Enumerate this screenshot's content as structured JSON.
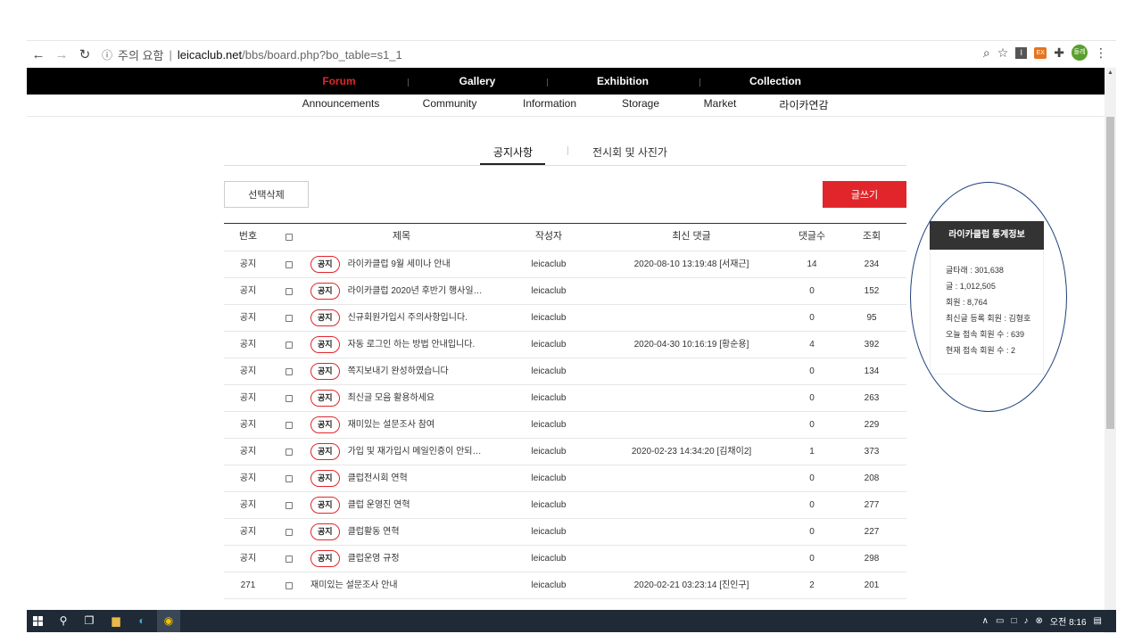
{
  "browser": {
    "security_label": "주의 요함",
    "url_host": "leicaclub.net",
    "url_path": "/bbs/board.php?bo_table=s1_1",
    "profile_text": "돌레"
  },
  "topnav": [
    "Forum",
    "Gallery",
    "Exhibition",
    "Collection"
  ],
  "subnav": [
    "Announcements",
    "Community",
    "Information",
    "Storage",
    "Market",
    "라이카연감"
  ],
  "tabs": [
    "공지사항",
    "전시회 및 사진가"
  ],
  "buttons": {
    "delete_selected": "선택삭제",
    "write": "글쓰기"
  },
  "table": {
    "headers": {
      "num": "번호",
      "title": "제목",
      "writer": "작성자",
      "last_comment": "최신 댓글",
      "comments": "댓글수",
      "views": "조회"
    },
    "notice_badge": "공지",
    "rows": [
      {
        "num": "공지",
        "notice": true,
        "title": "라이카클럽 9월 세미나 안내",
        "writer": "leicaclub",
        "last_comment": "2020-08-10 13:19:48 [서재근]",
        "comments": "14",
        "views": "234"
      },
      {
        "num": "공지",
        "notice": true,
        "title": "라이카클럽 2020년 후반기 행사일…",
        "writer": "leicaclub",
        "last_comment": "",
        "comments": "0",
        "views": "152"
      },
      {
        "num": "공지",
        "notice": true,
        "title": "신규회원가입시 주의사항입니다.",
        "writer": "leicaclub",
        "last_comment": "",
        "comments": "0",
        "views": "95"
      },
      {
        "num": "공지",
        "notice": true,
        "title": "자동 로그인 하는 방법 안내입니다.",
        "writer": "leicaclub",
        "last_comment": "2020-04-30 10:16:19 [황순용]",
        "comments": "4",
        "views": "392"
      },
      {
        "num": "공지",
        "notice": true,
        "title": "쪽지보내기 완성하였습니다",
        "writer": "leicaclub",
        "last_comment": "",
        "comments": "0",
        "views": "134"
      },
      {
        "num": "공지",
        "notice": true,
        "title": "최신글 모음 활용하세요",
        "writer": "leicaclub",
        "last_comment": "",
        "comments": "0",
        "views": "263"
      },
      {
        "num": "공지",
        "notice": true,
        "title": "재미있는 설문조사 참여",
        "writer": "leicaclub",
        "last_comment": "",
        "comments": "0",
        "views": "229"
      },
      {
        "num": "공지",
        "notice": true,
        "title": "가입 및 재가입시 메일인증이 안되…",
        "writer": "leicaclub",
        "last_comment": "2020-02-23 14:34:20 [김채이2]",
        "comments": "1",
        "views": "373"
      },
      {
        "num": "공지",
        "notice": true,
        "title": "클럽전시회 연혁",
        "writer": "leicaclub",
        "last_comment": "",
        "comments": "0",
        "views": "208"
      },
      {
        "num": "공지",
        "notice": true,
        "title": "클럽 운영진 연혁",
        "writer": "leicaclub",
        "last_comment": "",
        "comments": "0",
        "views": "277"
      },
      {
        "num": "공지",
        "notice": true,
        "title": "클럽활동 연혁",
        "writer": "leicaclub",
        "last_comment": "",
        "comments": "0",
        "views": "227"
      },
      {
        "num": "공지",
        "notice": true,
        "title": "클럽운영 규정",
        "writer": "leicaclub",
        "last_comment": "",
        "comments": "0",
        "views": "298"
      },
      {
        "num": "271",
        "notice": false,
        "title": "재미있는 설문조사 안내",
        "writer": "leicaclub",
        "last_comment": "2020-02-21 03:23:14 [진인구]",
        "comments": "2",
        "views": "201"
      }
    ]
  },
  "stats": {
    "title": "라이카클럽 통계정보",
    "lines": [
      "글타래 : 301,638",
      "글 : 1,012,505",
      "회원 : 8,764",
      "최신글 등록 회원 : 김형호",
      "오늘 접속 회원 수 : 639",
      "현재 접속 회원 수 : 2"
    ]
  },
  "taskbar": {
    "time": "오전 8:16"
  }
}
